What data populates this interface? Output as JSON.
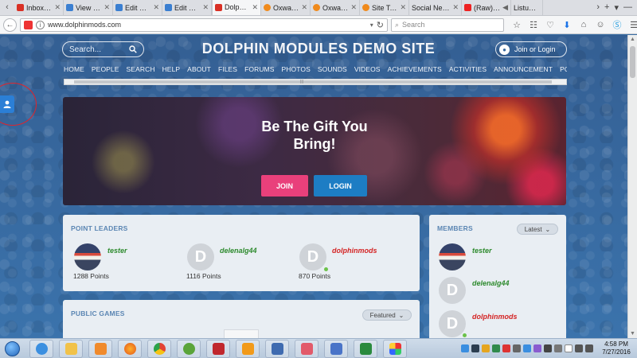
{
  "browser": {
    "tabs": [
      {
        "title": "Inbox (76…",
        "color": "#d93025"
      },
      {
        "title": "View mes…",
        "color": "#3b7fd1"
      },
      {
        "title": "Edit Prod…",
        "color": "#3b7fd1"
      },
      {
        "title": "Edit Prod…",
        "color": "#3b7fd1"
      },
      {
        "title": "Dolph…",
        "color": "#d93025",
        "active": true
      },
      {
        "title": "Oxwall ®…",
        "color": "#f08a1c"
      },
      {
        "title": "Oxwall St…",
        "color": "#f08a1c"
      },
      {
        "title": "Site Tour…",
        "color": "#f08a1c"
      },
      {
        "title": "Social Netwo…",
        "color": "#cccccc"
      },
      {
        "title": "(Raw)…",
        "color": "#e22"
      },
      {
        "title": "Listu…",
        "color": "#cccccc"
      }
    ],
    "url": "www.dolphinmods.com",
    "search_placeholder": "Search"
  },
  "site": {
    "search_placeholder": "Search...",
    "title": "DOLPHIN MODULES DEMO SITE",
    "login_label": "Join or Login",
    "menu": [
      "HOME",
      "PEOPLE",
      "SEARCH",
      "HELP",
      "ABOUT",
      "FILES",
      "FORUMS",
      "PHOTOS",
      "SOUNDS",
      "VIDEOS",
      "ACHIEVEMENTS",
      "ACTIVITIES",
      "ANNOUNCEMENT",
      "POIN"
    ]
  },
  "hero": {
    "line1": "Be The Gift You",
    "line2": "Bring!",
    "join_label": "JOIN",
    "login_label": "LOGIN"
  },
  "point_leaders": {
    "title": "POINT LEADERS",
    "leaders": [
      {
        "name": "tester",
        "points": "1288 Points",
        "initial": "",
        "photo": true
      },
      {
        "name": "delenalg44",
        "points": "1116 Points",
        "initial": "D"
      },
      {
        "name": "dolphinmods",
        "points": "870 Points",
        "initial": "D"
      }
    ]
  },
  "members": {
    "title": "MEMBERS",
    "filter_label": "Latest",
    "list": [
      {
        "name": "tester",
        "initial": "",
        "photo": true
      },
      {
        "name": "delenalg44",
        "initial": "D"
      },
      {
        "name": "dolphinmods",
        "initial": "D"
      }
    ]
  },
  "public_games": {
    "title": "PUBLIC GAMES",
    "filter_label": "Featured"
  },
  "taskbar": {
    "time": "4:58 PM",
    "date": "7/27/2016"
  }
}
